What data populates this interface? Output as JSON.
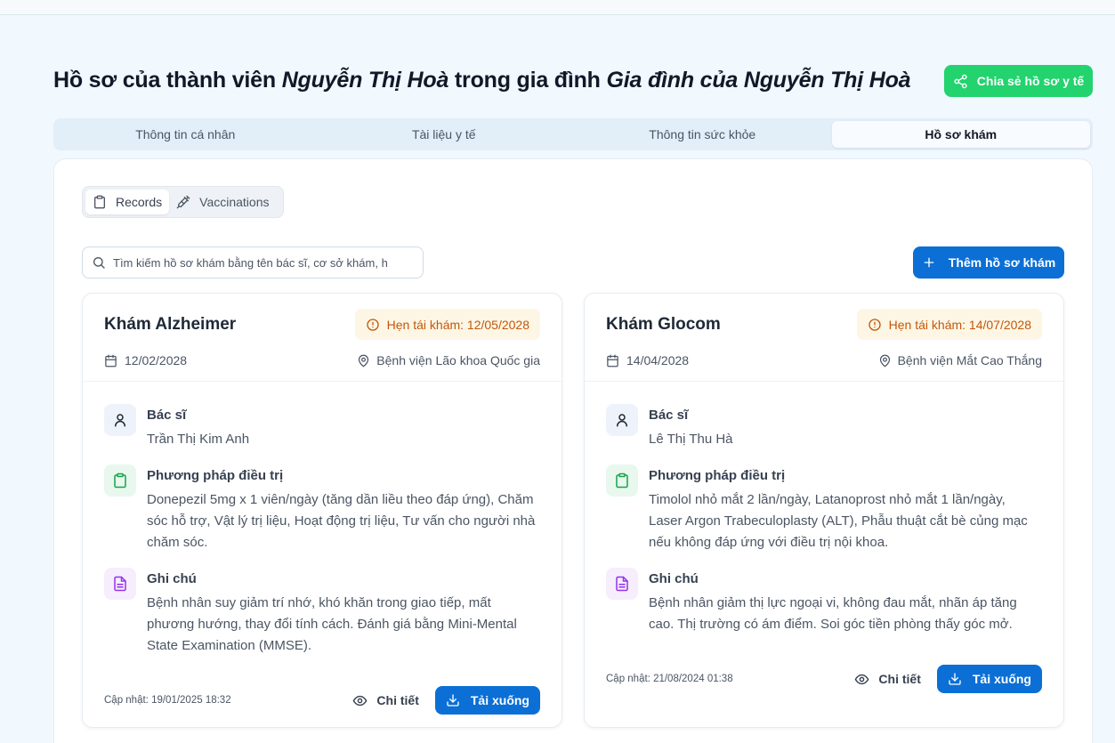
{
  "header": {
    "title_prefix": "Hồ sơ của thành viên ",
    "member_name": "Nguyễn Thị Hoà",
    "title_middle": " trong gia đình ",
    "family_name": "Gia đình của Nguyễn Thị Hoà",
    "share_label": "Chia sẻ hồ sơ y tế"
  },
  "tabs": [
    {
      "label": "Thông tin cá nhân"
    },
    {
      "label": "Tài liệu y tế"
    },
    {
      "label": "Thông tin sức khỏe"
    },
    {
      "label": "Hồ sơ khám",
      "active": true
    }
  ],
  "segments": {
    "records": "Records",
    "vaccinations": "Vaccinations"
  },
  "search": {
    "placeholder": "Tìm kiếm hồ sơ khám bằng tên bác sĩ, cơ sở khám, h"
  },
  "add_button": "Thêm hồ sơ khám",
  "records": [
    {
      "title": "Khám Alzheimer",
      "followup": "Hẹn tái khám: 12/05/2028",
      "date": "12/02/2028",
      "location": "Bệnh viện Lão khoa Quốc gia",
      "doctor_label": "Bác sĩ",
      "doctor": "Trần Thị Kim Anh",
      "treatment_label": "Phương pháp điều trị",
      "treatment": "Donepezil 5mg x 1 viên/ngày (tăng dần liều theo đáp ứng), Chăm sóc hỗ trợ, Vật lý trị liệu, Hoạt động trị liệu, Tư vấn cho người nhà chăm sóc.",
      "notes_label": "Ghi chú",
      "notes": "Bệnh nhân suy giảm trí nhớ, khó khăn trong giao tiếp, mất phương hướng, thay đổi tính cách. Đánh giá bằng Mini-Mental State Examination (MMSE).",
      "updated": "Cập nhật: 19/01/2025 18:32",
      "detail_label": "Chi tiết",
      "download_label": "Tải xuống"
    },
    {
      "title": "Khám Glocom",
      "followup": "Hẹn tái khám: 14/07/2028",
      "date": "14/04/2028",
      "location": "Bệnh viện Mắt Cao Thắng",
      "doctor_label": "Bác sĩ",
      "doctor": "Lê Thị Thu Hà",
      "treatment_label": "Phương pháp điều trị",
      "treatment": "Timolol nhỏ mắt 2 lần/ngày, Latanoprost nhỏ mắt 1 lần/ngày, Laser Argon Trabeculoplasty (ALT), Phẫu thuật cắt bè củng mạc nếu không đáp ứng với điều trị nội khoa.",
      "notes_label": "Ghi chú",
      "notes": "Bệnh nhân giảm thị lực ngoại vi, không đau mắt, nhãn áp tăng cao. Thị trường có ám điểm. Soi góc tiền phòng thấy góc mở.",
      "updated": "Cập nhật: 21/08/2024 01:38",
      "detail_label": "Chi tiết",
      "download_label": "Tải xuống"
    }
  ],
  "colors": {
    "primary": "#0b6fd6",
    "share": "#22d36e",
    "badge_bg": "#fef6e4",
    "badge_text": "#c2570c",
    "background": "#f1f8fe"
  }
}
